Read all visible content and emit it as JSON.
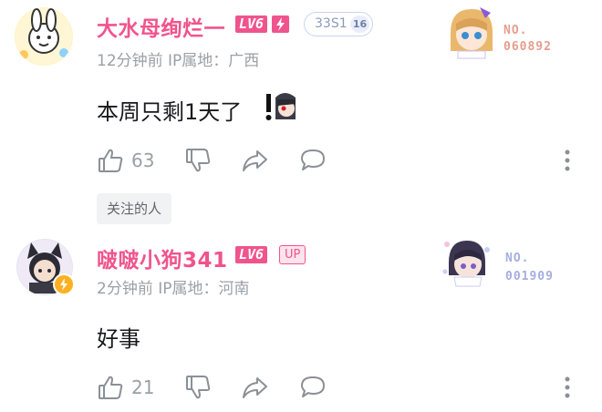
{
  "comments": [
    {
      "username": "大水母绚烂一",
      "level": "LV6",
      "medal": {
        "name": "33S1",
        "level": "16"
      },
      "meta": "12分钟前  IP属地：广西",
      "text": "本周只剩1天了",
      "likes": "63",
      "card_no_label": "NO.",
      "card_no": "060892"
    },
    {
      "username": "啵啵小狗341",
      "level": "LV6",
      "up_badge": "UP",
      "meta": "2分钟前  IP属地：河南",
      "text": "好事",
      "likes": "21",
      "card_no_label": "NO.",
      "card_no": "001909"
    }
  ],
  "followed_tag": "关注的人",
  "colors": {
    "username": "#f0548d",
    "level_badge": "#f0548d",
    "meta_text": "#9aa0a6",
    "content_text": "#18191c",
    "icon": "#8a9096",
    "medal_border": "#c9d4ee",
    "medal_text": "#8b9ab8",
    "card_no_c1": "#e59d8e",
    "card_no_c2": "#a5aee0"
  },
  "icons": [
    "thumb-up-icon",
    "thumb-down-icon",
    "share-icon",
    "reply-icon",
    "more-icon"
  ]
}
